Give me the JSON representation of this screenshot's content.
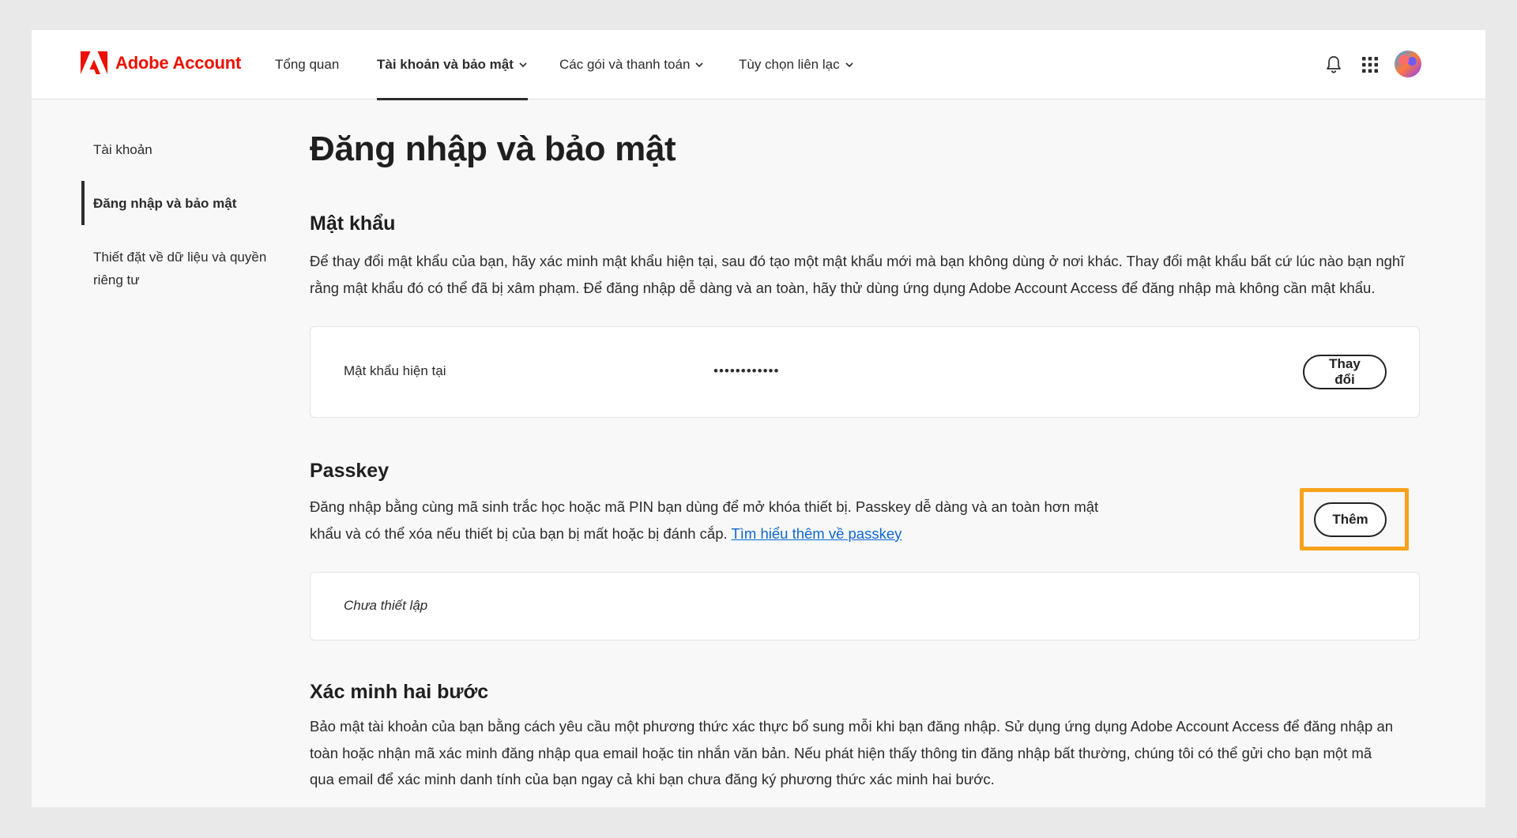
{
  "header": {
    "brand_name": "Adobe Account",
    "brand_color": "#eb1000",
    "nav": [
      {
        "label": "Tổng quan",
        "active": false,
        "dropdown": false
      },
      {
        "label": "Tài khoản và bảo mật",
        "active": true,
        "dropdown": true
      },
      {
        "label": "Các gói và thanh toán",
        "active": false,
        "dropdown": true
      },
      {
        "label": "Tùy chọn liên lạc",
        "active": false,
        "dropdown": true
      }
    ],
    "icons": [
      "bell-icon",
      "apps-grid-icon",
      "avatar"
    ]
  },
  "sidebar": {
    "items": [
      {
        "label": "Tài khoản",
        "active": false
      },
      {
        "label": "Đăng nhập và bảo mật",
        "active": true
      },
      {
        "label_line1": "Thiết đặt về dữ liệu và quyền",
        "label_line2": "riêng tư",
        "active": false
      }
    ]
  },
  "main": {
    "title": "Đăng nhập và bảo mật",
    "password": {
      "title": "Mật khẩu",
      "desc_line1": "Để thay đổi mật khẩu của bạn, hãy xác minh mật khẩu hiện tại, sau đó tạo một mật khẩu mới mà bạn không dùng ở nơi khác. Thay đổi mật khẩu bất cứ lúc nào bạn nghĩ",
      "desc_line2": "rằng mật khẩu đó có thể đã bị xâm phạm. Để đăng nhập dễ dàng và an toàn, hãy thử dùng ứng dụng Adobe Account Access để đăng nhập mà không cần mật khẩu.",
      "current_label": "Mật khẩu hiện tại",
      "current_value": "••••••••••••",
      "change_button": "Thay đổi"
    },
    "passkey": {
      "title": "Passkey",
      "desc_line1": "Đăng nhập bằng cùng mã sinh trắc học hoặc mã PIN bạn dùng để mở khóa thiết bị. Passkey dễ dàng và an toàn hơn mật",
      "desc_line2": "khẩu và có thể xóa nếu thiết bị của bạn bị mất hoặc bị đánh cắp.",
      "learn_more": "Tìm hiểu thêm về passkey",
      "add_button": "Thêm",
      "status": "Chưa thiết lập",
      "highlight_color": "#f7a21b"
    },
    "two_step": {
      "title": "Xác minh hai bước",
      "desc_line1": "Bảo mật tài khoản của bạn bằng cách yêu cầu một phương thức xác thực bổ sung mỗi khi bạn đăng nhập. Sử dụng ứng dụng Adobe Account Access để đăng nhập an",
      "desc_line2": "toàn hoặc nhận mã xác minh đăng nhập qua email hoặc tin nhắn văn bản. Nếu phát hiện thấy thông tin đăng nhập bất thường, chúng tôi có thể gửi cho bạn một mã",
      "desc_line3": "qua email để xác minh danh tính của bạn ngay cả khi bạn chưa đăng ký phương thức xác minh hai bước."
    }
  }
}
